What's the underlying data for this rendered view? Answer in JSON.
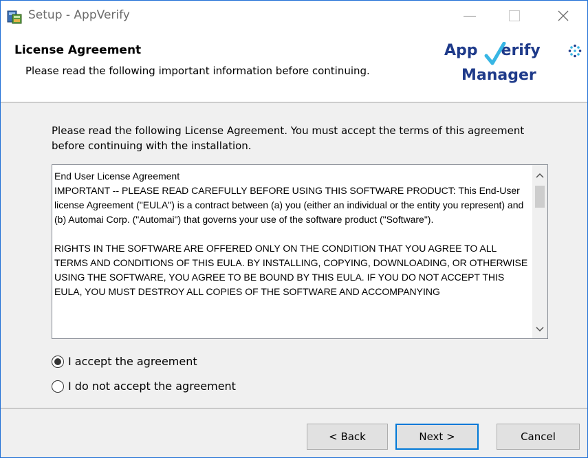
{
  "window": {
    "title": "Setup - AppVerify"
  },
  "header": {
    "title": "License Agreement",
    "subtitle": "Please read the following important information before continuing.",
    "logo_top_left": "App",
    "logo_top_right": "erify",
    "logo_bottom": "Manager"
  },
  "body": {
    "intro": "Please read the following License Agreement. You must accept the terms of this agreement before continuing with the installation.",
    "eula_text": "End User License Agreement\nIMPORTANT -- PLEASE READ CAREFULLY BEFORE USING THIS SOFTWARE PRODUCT: This End-User license Agreement (\"EULA\") is a contract between (a) you (either an individual or the entity you represent) and (b) Automai Corp. (\"Automai\") that governs your use of the software product (\"Software\").\n\nRIGHTS IN THE SOFTWARE ARE OFFERED ONLY ON THE CONDITION THAT YOU AGREE TO ALL TERMS AND CONDITIONS OF THIS EULA. BY INSTALLING, COPYING, DOWNLOADING, OR OTHERWISE USING THE SOFTWARE, YOU AGREE TO BE BOUND BY THIS EULA. IF YOU DO NOT ACCEPT THIS EULA, YOU MUST DESTROY ALL COPIES OF THE SOFTWARE AND ACCOMPANYING",
    "radio_accept": "I accept the agreement",
    "radio_decline": "I do not accept the agreement",
    "selected": "accept"
  },
  "buttons": {
    "back": "< Back",
    "next": "Next >",
    "cancel": "Cancel"
  },
  "icons": {
    "app": "installer-icon",
    "minimize": "minimize-icon",
    "maximize": "maximize-icon",
    "close": "close-icon",
    "scroll_up": "chevron-up-icon",
    "scroll_down": "chevron-down-icon"
  },
  "colors": {
    "accent": "#0078d7",
    "logo_dark": "#1e3a8a",
    "logo_light": "#38b6e4"
  }
}
